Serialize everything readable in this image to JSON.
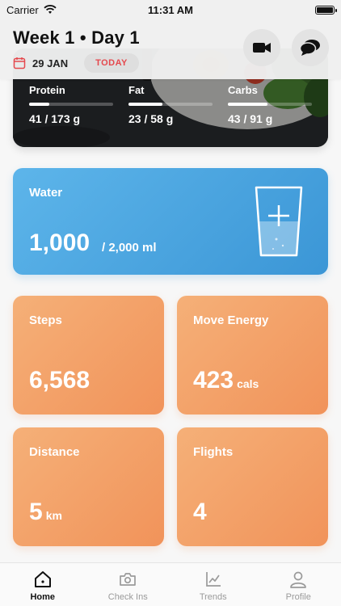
{
  "status_bar": {
    "carrier": "Carrier",
    "time": "11:31 AM"
  },
  "header": {
    "title": "Week 1 • Day 1",
    "date": "29 JAN",
    "today_label": "TODAY",
    "icons": {
      "calendar": "calendar-icon",
      "video": "video-camera-icon",
      "chat": "chat-bubbles-icon"
    }
  },
  "macros": [
    {
      "name": "Protein",
      "consumed": 41,
      "goal": 173,
      "value_text": "41 / 173 g"
    },
    {
      "name": "Fat",
      "consumed": 23,
      "goal": 58,
      "value_text": "23 / 58 g"
    },
    {
      "name": "Carbs",
      "consumed": 43,
      "goal": 91,
      "value_text": "43 / 91 g"
    }
  ],
  "water": {
    "label": "Water",
    "amount": "1,000",
    "goal_text": "/  2,000 ml",
    "progress": 0.5
  },
  "tiles": {
    "steps": {
      "label": "Steps",
      "value": "6,568",
      "unit": ""
    },
    "move_energy": {
      "label": "Move Energy",
      "value": "423",
      "unit": "cals"
    },
    "distance": {
      "label": "Distance",
      "value": "5",
      "unit": "km"
    },
    "flights": {
      "label": "Flights",
      "value": "4",
      "unit": ""
    }
  },
  "tabbar": {
    "items": [
      {
        "label": "Home",
        "icon": "home-icon",
        "active": true
      },
      {
        "label": "Check Ins",
        "icon": "camera-icon",
        "active": false
      },
      {
        "label": "Trends",
        "icon": "trend-chart-icon",
        "active": false
      },
      {
        "label": "Profile",
        "icon": "profile-icon",
        "active": false
      }
    ]
  },
  "colors": {
    "accent_red": "#e5484d",
    "water_blue": "#3b96d6",
    "tile_orange": "#f1935a"
  }
}
